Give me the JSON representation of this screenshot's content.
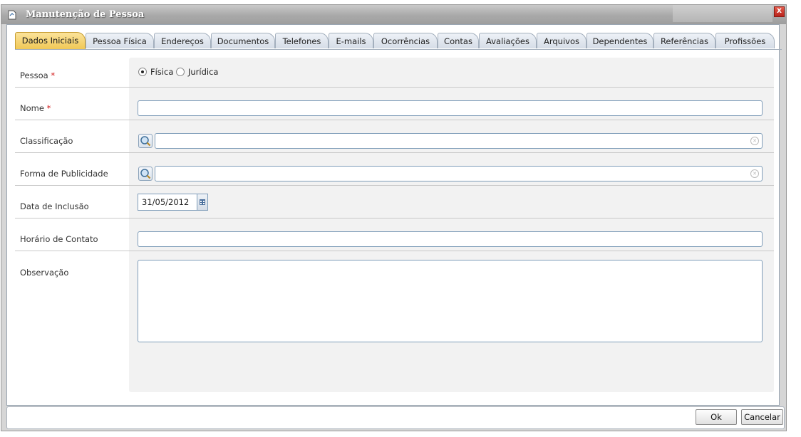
{
  "window": {
    "title": "Manutenção de Pessoa",
    "close_label": "X"
  },
  "tabs": [
    {
      "label": "Dados Iniciais",
      "active": true
    },
    {
      "label": "Pessoa Física"
    },
    {
      "label": "Endereços"
    },
    {
      "label": "Documentos"
    },
    {
      "label": "Telefones"
    },
    {
      "label": "E-mails"
    },
    {
      "label": "Ocorrências"
    },
    {
      "label": "Contas"
    },
    {
      "label": "Avaliações"
    },
    {
      "label": "Arquivos"
    },
    {
      "label": "Dependentes"
    },
    {
      "label": "Referências"
    },
    {
      "label": "Profissões"
    }
  ],
  "form": {
    "pessoa": {
      "label": "Pessoa",
      "required_mark": "*",
      "options": [
        {
          "label": "Física",
          "checked": true
        },
        {
          "label": "Jurídica",
          "checked": false
        }
      ]
    },
    "nome": {
      "label": "Nome",
      "required_mark": "*",
      "value": ""
    },
    "classificacao": {
      "label": "Classificação",
      "value": ""
    },
    "forma_publicidade": {
      "label": "Forma de Publicidade",
      "value": ""
    },
    "data_inclusao": {
      "label": "Data de Inclusão",
      "value": "31/05/2012"
    },
    "horario_contato": {
      "label": "Horário de Contato",
      "value": ""
    },
    "observacao": {
      "label": "Observação",
      "value": ""
    }
  },
  "footer": {
    "ok_label": "Ok",
    "cancel_label": "Cancelar"
  },
  "icons": {
    "window_icon": "document-icon",
    "lookup_icon": "magnifier-icon",
    "clear_icon": "clear-icon",
    "calendar_icon": "calendar-icon"
  },
  "colors": {
    "active_tab": "#f1c856",
    "required": "#d21a1a",
    "close": "#c9342a"
  }
}
